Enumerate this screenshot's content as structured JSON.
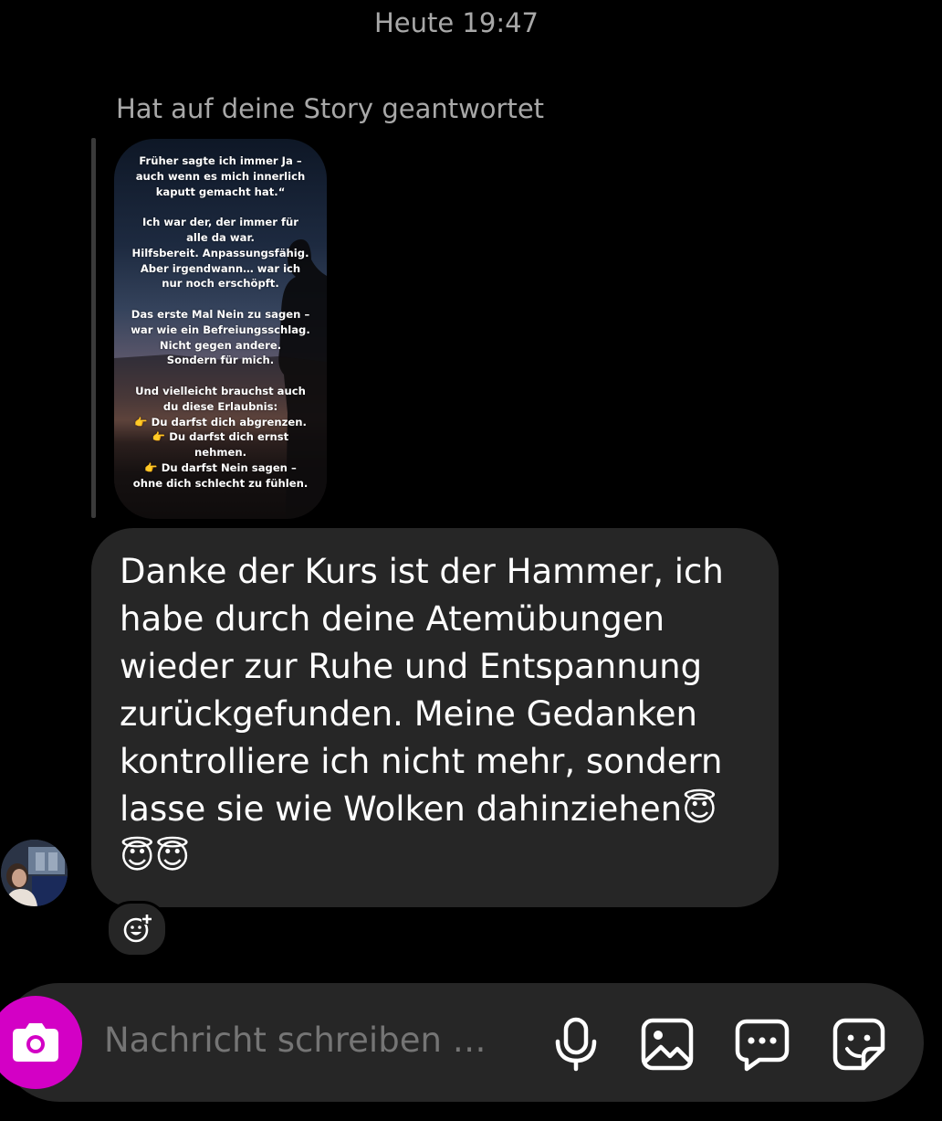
{
  "header": {
    "timestamp": "Heute 19:47"
  },
  "story_reply": {
    "label": "Hat auf deine Story geantwortet",
    "story_text": "Früher sagte ich immer Ja –\nauch wenn es mich innerlich\nkaputt gemacht hat.“\n\nIch war der, der immer für\nalle da war.\nHilfsbereit. Anpassungsfähig.\nAber irgendwann… war ich\nnur noch erschöpft.\n\nDas erste Mal Nein zu sagen –\nwar wie ein Befreiungsschlag.\nNicht gegen andere.\nSondern für mich.\n\nUnd vielleicht brauchst auch\ndu diese Erlaubnis:\n👉 Du darfst dich abgrenzen.\n👉 Du darfst dich ernst\nnehmen.\n👉 Du darfst Nein sagen –\nohne dich schlecht zu fühlen."
  },
  "message": {
    "text": "Danke der Kurs ist der Hammer, ich\nhabe durch deine Atemübungen\nwieder zur Ruhe und Entspannung\nzurückgefunden. Meine Gedanken\nkontrolliere ich nicht mehr, sondern\nlasse sie wie Wolken dahinziehen😇\n😇😇"
  },
  "composer": {
    "placeholder": "Nachricht schreiben …",
    "icons": [
      "camera-icon",
      "microphone-icon",
      "gallery-icon",
      "chat-bubble-icon",
      "sticker-icon"
    ],
    "accent_color": "#d300c5"
  },
  "icons": {
    "reaction": "add-reaction-icon"
  }
}
